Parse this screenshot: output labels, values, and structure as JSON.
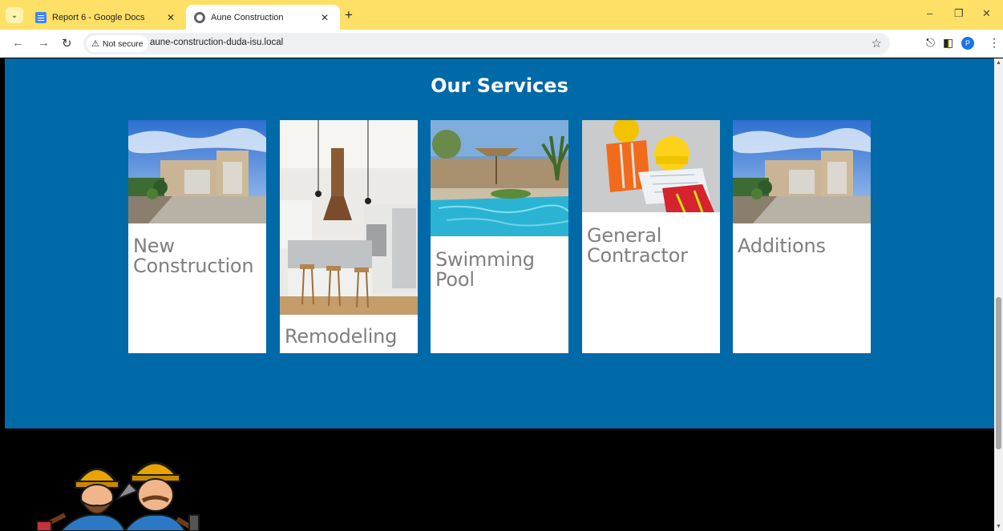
{
  "browser": {
    "tabs": [
      {
        "title": "Report 6 - Google Docs",
        "icon": "google-docs-icon"
      },
      {
        "title": "Aune Construction",
        "icon": "globe-icon",
        "active": true
      }
    ],
    "new_tab": "+",
    "security_label": "Not secure",
    "url": "aune-construction-duda-isu.local",
    "profile_initial": "P"
  },
  "page": {
    "section_title": "Our Services",
    "services": [
      {
        "label": "New Construction",
        "image": "house-exterior-photo"
      },
      {
        "label": "Remodeling",
        "image": "kitchen-interior-photo"
      },
      {
        "label": "Swimming Pool",
        "image": "swimming-pool-photo"
      },
      {
        "label": "General Contractor",
        "image": "contractors-blueprint-photo"
      },
      {
        "label": "Additions",
        "image": "house-exterior-photo"
      }
    ],
    "footer": {
      "logo": "two-construction-workers-mascot-logo"
    }
  },
  "colors": {
    "tabbar": "#ffe066",
    "services_bg": "#0069a8",
    "card_label": "#7f7f7f",
    "footer_bg": "#000000"
  }
}
